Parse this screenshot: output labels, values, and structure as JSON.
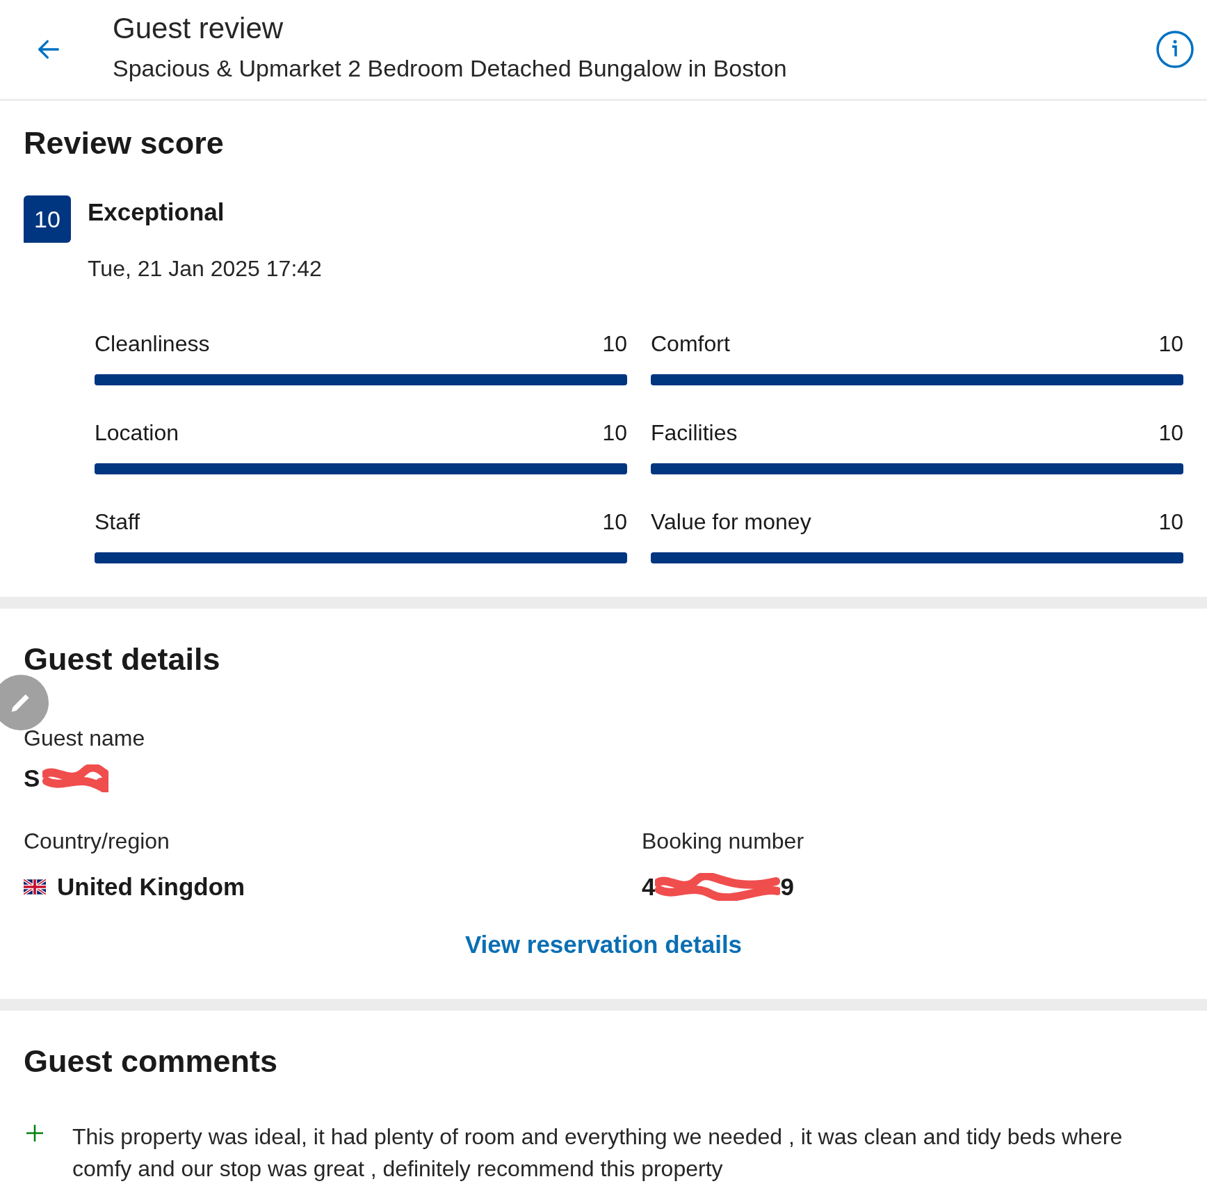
{
  "header": {
    "title": "Guest review",
    "subtitle": "Spacious & Upmarket 2 Bedroom Detached Bungalow in Boston"
  },
  "review_score": {
    "heading": "Review score",
    "score": "10",
    "rating": "Exceptional",
    "date": "Tue, 21 Jan 2025 17:42",
    "categories": [
      {
        "label": "Cleanliness",
        "value": "10",
        "level": 1
      },
      {
        "label": "Comfort",
        "value": "10",
        "level": 1
      },
      {
        "label": "Location",
        "value": "10",
        "level": 1
      },
      {
        "label": "Facilities",
        "value": "10",
        "level": 1
      },
      {
        "label": "Staff",
        "value": "10",
        "level": 1
      },
      {
        "label": "Value for money",
        "value": "10",
        "level": 1
      }
    ]
  },
  "guest_details": {
    "heading": "Guest details",
    "name_label": "Guest name",
    "name_visible": "S",
    "country_label": "Country/region",
    "country": "United Kingdom",
    "booking_label": "Booking number",
    "booking_start": "4",
    "booking_end": "9",
    "link": "View reservation details"
  },
  "guest_comments": {
    "heading": "Guest comments",
    "comments": [
      {
        "kind": "positive",
        "text": "This property was ideal, it had plenty of room and everything we needed , it was clean and tidy beds where comfy and our stop was great , definitely recommend this property"
      }
    ]
  }
}
